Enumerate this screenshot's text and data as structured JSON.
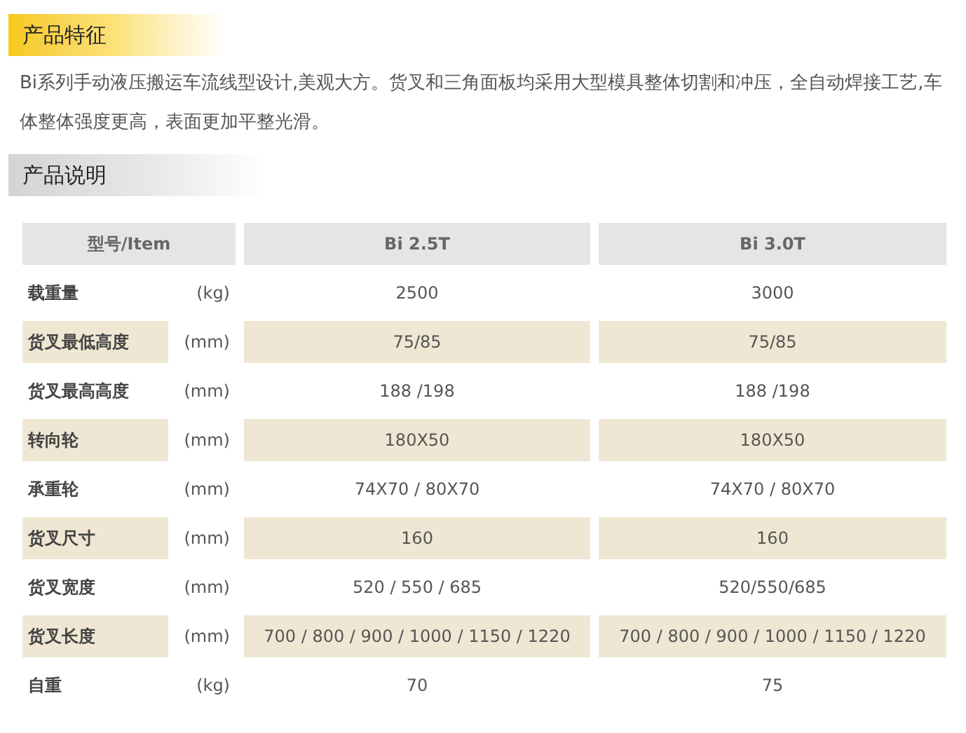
{
  "sections": [
    {
      "title": "产品特征",
      "kind": "feature"
    },
    {
      "title": "产品说明",
      "kind": "spec"
    }
  ],
  "description": "Bi系列手动液压搬运车流线型设计,美观大方。货叉和三角面板均采用大型模具整体切割和冲压，全自动焊接工艺,车体整体强度更高，表面更加平整光滑。",
  "table": {
    "columns": [
      "型号/Item",
      "Bi 2.5T",
      "Bi 3.0T"
    ],
    "rows": [
      {
        "name": "载重量",
        "unit": "(kg)",
        "values": [
          "2500",
          "3000"
        ],
        "highlighted": false
      },
      {
        "name": "货叉最低高度",
        "unit": "(mm)",
        "values": [
          "75/85",
          "75/85"
        ],
        "highlighted": true
      },
      {
        "name": "货叉最高高度",
        "unit": "(mm)",
        "values": [
          "188 /198",
          "188 /198"
        ],
        "highlighted": false
      },
      {
        "name": "转向轮",
        "unit": "(mm)",
        "values": [
          "180X50",
          "180X50"
        ],
        "highlighted": true
      },
      {
        "name": "承重轮",
        "unit": "(mm)",
        "values": [
          "74X70 / 80X70",
          "74X70 / 80X70"
        ],
        "highlighted": false
      },
      {
        "name": "货叉尺寸",
        "unit": "(mm)",
        "values": [
          "160",
          "160"
        ],
        "highlighted": true
      },
      {
        "name": "货叉宽度",
        "unit": "(mm)",
        "values": [
          "520 / 550 / 685",
          "520/550/685"
        ],
        "highlighted": false
      },
      {
        "name": "货叉长度",
        "unit": "(mm)",
        "values": [
          "700 / 800 / 900 / 1000 / 1150 / 1220",
          "700 / 800 / 900 / 1000 / 1150 / 1220"
        ],
        "highlighted": true
      },
      {
        "name": "自重",
        "unit": "(kg)",
        "values": [
          "70",
          "75"
        ],
        "highlighted": false
      }
    ]
  }
}
